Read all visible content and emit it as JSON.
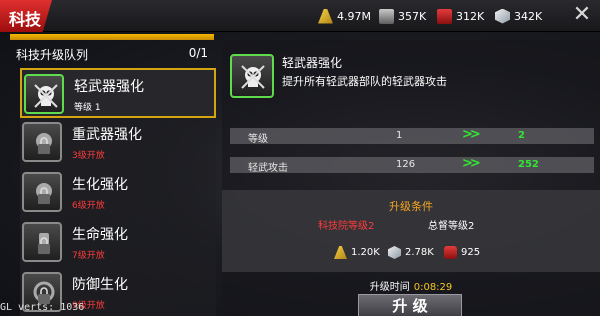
{
  "title": "科技",
  "resources": [
    {
      "icon": "wheat-icon",
      "value": "4.97M"
    },
    {
      "icon": "iron-icon",
      "value": "357K"
    },
    {
      "icon": "oil-barrel-icon",
      "value": "312K"
    },
    {
      "icon": "steel-cube-icon",
      "value": "342K"
    }
  ],
  "close": "✕",
  "queue": {
    "title": "科技升级队列",
    "count": "0/1"
  },
  "techs": [
    {
      "name": "轻武器强化",
      "sub": "等级 1"
    },
    {
      "name": "重武器强化",
      "sub": "3级开放"
    },
    {
      "name": "生化强化",
      "sub": "6级开放"
    },
    {
      "name": "生命强化",
      "sub": "7级开放"
    },
    {
      "name": "防御生化",
      "sub": "9级开放"
    }
  ],
  "detail": {
    "title": "轻武器强化",
    "desc": "提升所有轻武器部队的轻武器攻击",
    "stats": [
      {
        "label": "等级",
        "current": "1",
        "arrow": ">>",
        "next": "2"
      },
      {
        "label": "轻武攻击",
        "current": "126",
        "arrow": ">>",
        "next": "252"
      }
    ],
    "cond_title": "升级条件",
    "req_a": "科技院等级2",
    "req_b": "总督等级2",
    "costs": [
      {
        "icon": "wheat-icon",
        "value": "1.20K"
      },
      {
        "icon": "steel-cube-icon",
        "value": "2.78K"
      },
      {
        "icon": "oil-barrel-icon",
        "value": "925"
      }
    ],
    "time_label": "升级时间",
    "time_value": "0:08:29",
    "upgrade": "升 级"
  },
  "debug": "GL verts:  1036"
}
